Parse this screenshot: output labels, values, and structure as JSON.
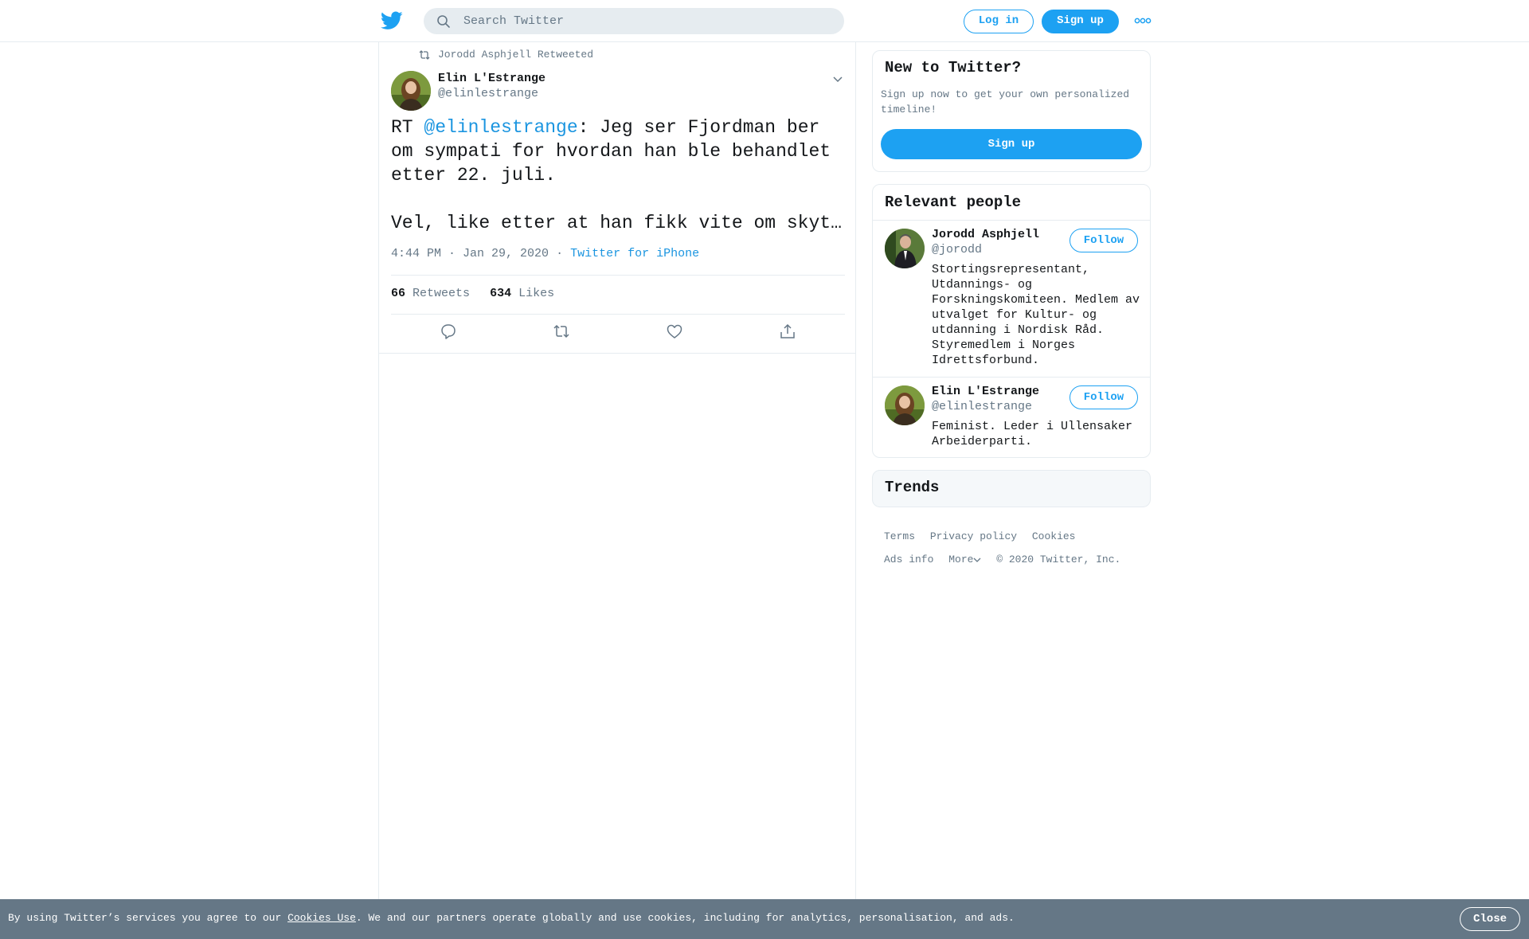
{
  "header": {
    "logo_icon": "twitter-bird-icon",
    "search_placeholder": "Search Twitter",
    "search_icon": "search-icon",
    "login_label": "Log in",
    "signup_label": "Sign up",
    "more_icon": "more-dots-icon"
  },
  "colors": {
    "brand": "#1da1f2",
    "link": "#1b95e0",
    "muted": "#657786",
    "cookie_bar": "#657786"
  },
  "tweet": {
    "retweet_context": "Jorodd Asphjell Retweeted",
    "author_name": "Elin L'Estrange",
    "author_handle": "@elinlestrange",
    "text_prefix": "RT ",
    "text_mention": "@elinlestrange",
    "text_rest": ": Jeg ser Fjordman ber om sympati for hvordan han ble behandlet etter 22. juli.\n\nVel, like etter at han fikk vite om skyt…",
    "timestamp": "4:44 PM · Jan 29, 2020",
    "separator": "·",
    "source": "Twitter for iPhone",
    "retweets_count": "66",
    "retweets_label": "Retweets",
    "likes_count": "634",
    "likes_label": "Likes",
    "actions": [
      "reply-icon",
      "retweet-icon",
      "like-icon",
      "share-icon"
    ]
  },
  "sidebar": {
    "signup_card": {
      "title": "New to Twitter?",
      "description": "Sign up now to get your own personalized timeline!",
      "button_label": "Sign up"
    },
    "people_card": {
      "title": "Relevant people",
      "people": [
        {
          "name": "Jorodd Asphjell",
          "handle": "@jorodd",
          "follow_label": "Follow",
          "bio": "Stortingsrepresentant, Utdannings- og Forskningskomiteen. Medlem av utvalget for Kultur- og utdanning i Nordisk Råd. Styremedlem i Norges Idrettsforbund."
        },
        {
          "name": "Elin L'Estrange",
          "handle": "@elinlestrange",
          "follow_label": "Follow",
          "bio": "Feminist. Leder i Ullensaker Arbeiderparti."
        }
      ]
    },
    "trends_card": {
      "title": "Trends"
    },
    "footer": {
      "links_row1": [
        "Terms",
        "Privacy policy",
        "Cookies"
      ],
      "links_row2": [
        "Ads info",
        "More"
      ],
      "copyright": "© 2020 Twitter, Inc."
    }
  },
  "cookie_bar": {
    "text_before": "By using Twitter’s services you agree to our ",
    "link_label": "Cookies Use",
    "text_after": ". We and our partners operate globally and use cookies, including for analytics, personalisation, and ads.",
    "close_label": "Close"
  }
}
